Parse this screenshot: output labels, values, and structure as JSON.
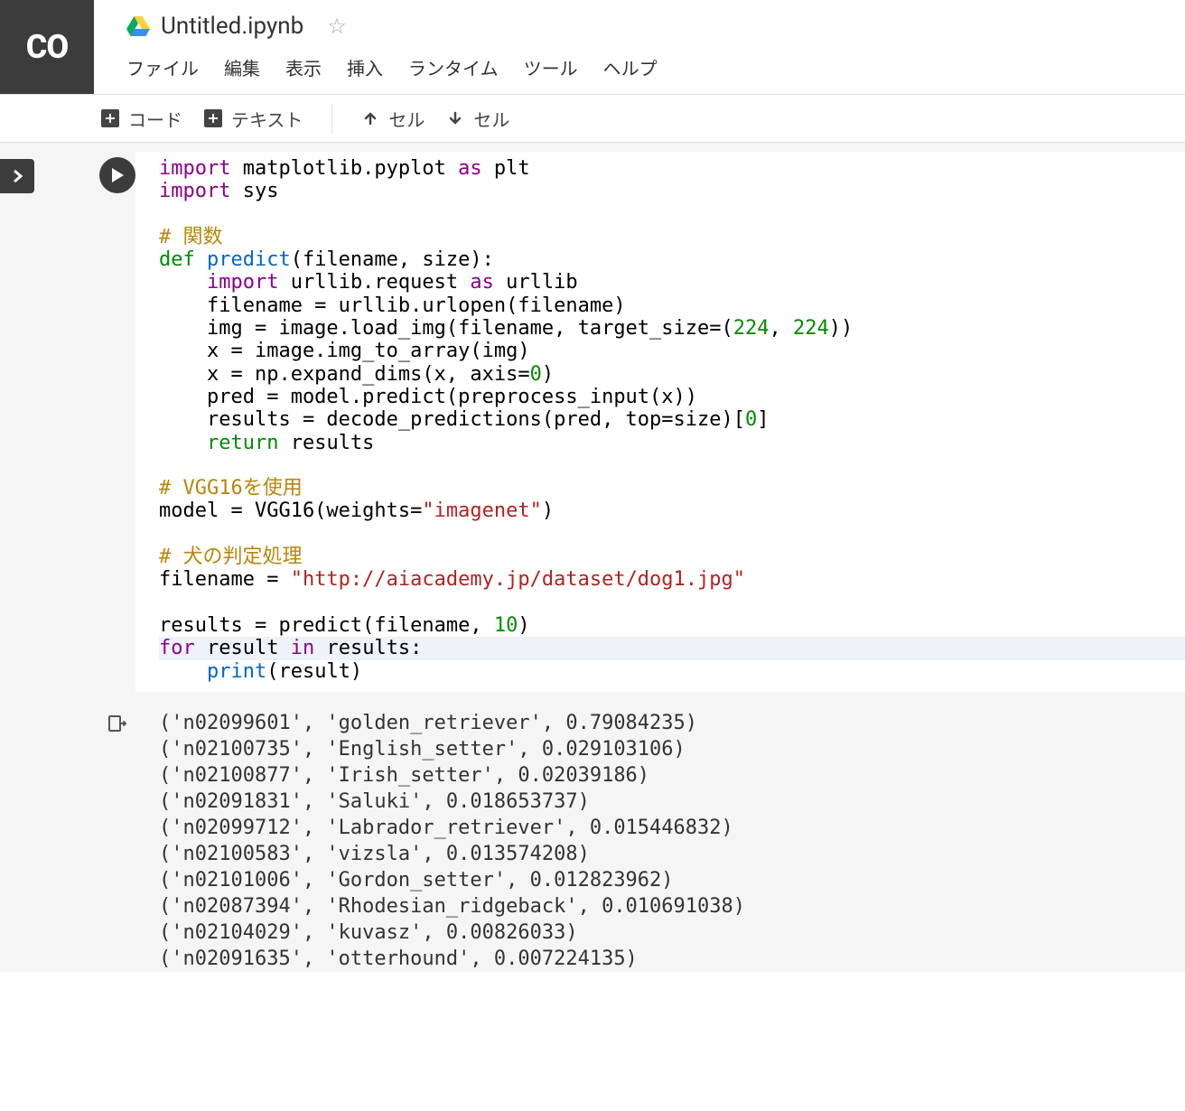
{
  "header": {
    "logo": "CO",
    "title": "Untitled.ipynb",
    "menu": [
      "ファイル",
      "編集",
      "表示",
      "挿入",
      "ランタイム",
      "ツール",
      "ヘルプ"
    ]
  },
  "toolbar": {
    "code": "コード",
    "text": "テキスト",
    "cell_up": "セル",
    "cell_down": "セル"
  },
  "code": {
    "l1_import": "import",
    "l1_mod": " matplotlib.pyplot ",
    "l1_as": "as",
    "l1_alias": " plt",
    "l2_import": "import",
    "l2_mod": " sys",
    "c1": "# 関数",
    "l3_def": "def ",
    "l3_fn": "predict",
    "l3_args": "(filename, size):",
    "l4_indent": "    ",
    "l4_import": "import",
    "l4_mod": " urllib.request ",
    "l4_as": "as",
    "l4_alias": " urllib",
    "l5": "    filename = urllib.urlopen(filename)",
    "l6a": "    img = image.load_img(filename, target_size=(",
    "l6n1": "224",
    "l6c": ", ",
    "l6n2": "224",
    "l6b": "))",
    "l7": "    x = image.img_to_array(img)",
    "l8a": "    x = np.expand_dims(x, axis=",
    "l8n": "0",
    "l8b": ")",
    "l9": "    pred = model.predict(preprocess_input(x))",
    "l10a": "    results = decode_predictions(pred, top=size)[",
    "l10n": "0",
    "l10b": "]",
    "l11_indent": "    ",
    "l11_ret": "return",
    "l11_val": " results",
    "c2": "# VGG16を使用",
    "l12a": "model = VGG16(weights=",
    "l12s": "\"imagenet\"",
    "l12b": ")",
    "c3": "# 犬の判定処理",
    "l13a": "filename = ",
    "l13s": "\"http://aiacademy.jp/dataset/dog1.jpg\"",
    "l14a": "results = predict(filename, ",
    "l14n": "10",
    "l14b": ")",
    "l15_for": "for",
    "l15_a": " result ",
    "l15_in": "in",
    "l15_b": " results:",
    "l16_indent": "    ",
    "l16_fn": "print",
    "l16_args": "(result)"
  },
  "output": [
    "('n02099601', 'golden_retriever', 0.79084235)",
    "('n02100735', 'English_setter', 0.029103106)",
    "('n02100877', 'Irish_setter', 0.02039186)",
    "('n02091831', 'Saluki', 0.018653737)",
    "('n02099712', 'Labrador_retriever', 0.015446832)",
    "('n02100583', 'vizsla', 0.013574208)",
    "('n02101006', 'Gordon_setter', 0.012823962)",
    "('n02087394', 'Rhodesian_ridgeback', 0.010691038)",
    "('n02104029', 'kuvasz', 0.00826033)",
    "('n02091635', 'otterhound', 0.007224135)"
  ]
}
